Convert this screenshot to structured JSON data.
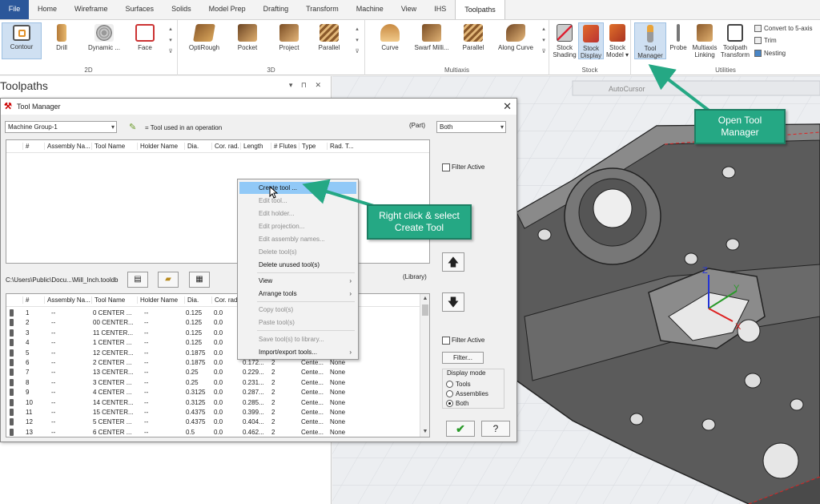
{
  "ribbon_tabs": [
    "File",
    "Home",
    "Wireframe",
    "Surfaces",
    "Solids",
    "Model Prep",
    "Drafting",
    "Transform",
    "Machine",
    "View",
    "IHS",
    "Toolpaths"
  ],
  "active_tab": "Toolpaths",
  "groups": {
    "g2d": {
      "label": "2D",
      "buttons": [
        {
          "label": "Contour",
          "icon": "contour-icon"
        },
        {
          "label": "Drill",
          "icon": "drill-icon"
        },
        {
          "label": "Dynamic ...",
          "icon": "dynamic-icon"
        },
        {
          "label": "Face",
          "icon": "face-icon"
        }
      ]
    },
    "g3d": {
      "label": "3D",
      "buttons": [
        {
          "label": "OptiRough",
          "icon": "optirough-icon"
        },
        {
          "label": "Pocket",
          "icon": "pocket-icon"
        },
        {
          "label": "Project",
          "icon": "project-icon"
        },
        {
          "label": "Parallel",
          "icon": "parallel-icon"
        }
      ]
    },
    "multiaxis": {
      "label": "Multiaxis",
      "buttons": [
        {
          "label": "Curve",
          "icon": "curve-icon"
        },
        {
          "label": "Swarf Milli...",
          "icon": "swarf-icon"
        },
        {
          "label": "Parallel",
          "icon": "parallel-icon"
        },
        {
          "label": "Along Curve",
          "icon": "along-curve-icon"
        }
      ]
    },
    "stock": {
      "label": "Stock",
      "buttons": [
        {
          "label1": "Stock",
          "label2": "Shading",
          "icon": "stock-shading-icon"
        },
        {
          "label1": "Stock",
          "label2": "Display",
          "icon": "stock-display-icon"
        },
        {
          "label1": "Stock",
          "label2": "Model ▾",
          "icon": "stock-model-icon"
        }
      ]
    },
    "utilities": {
      "label": "Utilities",
      "buttons": [
        {
          "label1": "Tool",
          "label2": "Manager",
          "icon": "tool-manager-icon"
        },
        {
          "label1": "Probe",
          "label2": "",
          "icon": "probe-icon"
        },
        {
          "label1": "Multiaxis",
          "label2": "Linking",
          "icon": "multiaxis-linking-icon"
        },
        {
          "label1": "Toolpath",
          "label2": "Transform",
          "icon": "toolpath-transform-icon"
        }
      ],
      "small": [
        "Convert to 5-axis",
        "Trim",
        "Nesting"
      ]
    }
  },
  "left_pane": {
    "title": "Toolpaths",
    "controls": "▾ ⊓ ✕"
  },
  "viewport": {
    "autocursor": "AutoCursor",
    "axes": {
      "x": "X",
      "y": "Y",
      "z": "Z"
    }
  },
  "dialog": {
    "title": "Tool Manager",
    "machine_group": "Machine Group-1",
    "legend_text": "= Tool used in an operation",
    "part_label": "(Part)",
    "filter_value": "Both",
    "columns_top": [
      "#",
      "Assembly Na...",
      "Tool Name",
      "Holder Name",
      "Dia.",
      "Cor. rad.",
      "Length",
      "# Flutes",
      "Type",
      "Rad. T..."
    ],
    "filter_active": "Filter Active",
    "library_path": "C:\\Users\\Public\\Docu...\\Mill_Inch.tooldb",
    "library_label": "(Library)",
    "columns_lib": [
      "#",
      "Assembly Na...",
      "Tool Name",
      "Holder Name",
      "Dia.",
      "Cor. rad."
    ],
    "rows": [
      {
        "n": "1",
        "asm": "--",
        "tool": "0 CENTER ...",
        "holder": "--",
        "dia": "0.125",
        "cor": "0.0",
        "len": "",
        "fl": "",
        "type": "",
        "rad": ""
      },
      {
        "n": "2",
        "asm": "--",
        "tool": "00 CENTER...",
        "holder": "--",
        "dia": "0.125",
        "cor": "0.0",
        "len": "",
        "fl": "",
        "type": "",
        "rad": ""
      },
      {
        "n": "3",
        "asm": "--",
        "tool": "11 CENTER...",
        "holder": "--",
        "dia": "0.125",
        "cor": "0.0",
        "len": "",
        "fl": "",
        "type": "",
        "rad": ""
      },
      {
        "n": "4",
        "asm": "--",
        "tool": "1 CENTER ...",
        "holder": "--",
        "dia": "0.125",
        "cor": "0.0",
        "len": "",
        "fl": "",
        "type": "",
        "rad": ""
      },
      {
        "n": "5",
        "asm": "--",
        "tool": "12 CENTER...",
        "holder": "--",
        "dia": "0.1875",
        "cor": "0.0",
        "len": "",
        "fl": "",
        "type": "",
        "rad": ""
      },
      {
        "n": "6",
        "asm": "--",
        "tool": "2 CENTER ...",
        "holder": "--",
        "dia": "0.1875",
        "cor": "0.0",
        "len": "0.172...",
        "fl": "2",
        "type": "Cente...",
        "rad": "None"
      },
      {
        "n": "7",
        "asm": "--",
        "tool": "13 CENTER...",
        "holder": "--",
        "dia": "0.25",
        "cor": "0.0",
        "len": "0.229...",
        "fl": "2",
        "type": "Cente...",
        "rad": "None"
      },
      {
        "n": "8",
        "asm": "--",
        "tool": "3 CENTER ...",
        "holder": "--",
        "dia": "0.25",
        "cor": "0.0",
        "len": "0.231...",
        "fl": "2",
        "type": "Cente...",
        "rad": "None"
      },
      {
        "n": "9",
        "asm": "--",
        "tool": "4 CENTER ...",
        "holder": "--",
        "dia": "0.3125",
        "cor": "0.0",
        "len": "0.287...",
        "fl": "2",
        "type": "Cente...",
        "rad": "None"
      },
      {
        "n": "10",
        "asm": "--",
        "tool": "14 CENTER...",
        "holder": "--",
        "dia": "0.3125",
        "cor": "0.0",
        "len": "0.285...",
        "fl": "2",
        "type": "Cente...",
        "rad": "None"
      },
      {
        "n": "11",
        "asm": "--",
        "tool": "15 CENTER...",
        "holder": "--",
        "dia": "0.4375",
        "cor": "0.0",
        "len": "0.399...",
        "fl": "2",
        "type": "Cente...",
        "rad": "None"
      },
      {
        "n": "12",
        "asm": "--",
        "tool": "5 CENTER ...",
        "holder": "--",
        "dia": "0.4375",
        "cor": "0.0",
        "len": "0.404...",
        "fl": "2",
        "type": "Cente...",
        "rad": "None"
      },
      {
        "n": "13",
        "asm": "--",
        "tool": "6 CENTER ...",
        "holder": "--",
        "dia": "0.5",
        "cor": "0.0",
        "len": "0.462...",
        "fl": "2",
        "type": "Cente...",
        "rad": "None"
      }
    ],
    "filter_button": "Filter...",
    "display_mode": {
      "label": "Display mode",
      "options": [
        "Tools",
        "Assemblies",
        "Both"
      ],
      "selected": "Both"
    }
  },
  "context_menu": [
    {
      "label": "Create tool ...",
      "state": "highlight",
      "sub": false
    },
    {
      "label": "Edit tool...",
      "state": "disabled",
      "sub": false
    },
    {
      "label": "Edit holder...",
      "state": "disabled",
      "sub": false
    },
    {
      "label": "Edit projection...",
      "state": "disabled",
      "sub": false
    },
    {
      "label": "Edit assembly names...",
      "state": "disabled",
      "sub": false
    },
    {
      "label": "Delete tool(s)",
      "state": "disabled",
      "sub": false
    },
    {
      "label": "Delete unused tool(s)",
      "state": "enabled",
      "sub": false
    },
    {
      "label": "View",
      "state": "enabled",
      "sub": true
    },
    {
      "label": "Arrange tools",
      "state": "enabled",
      "sub": true
    },
    {
      "label": "Copy tool(s)",
      "state": "disabled",
      "sub": false
    },
    {
      "label": "Paste tool(s)",
      "state": "disabled",
      "sub": false
    },
    {
      "label": "Save tool(s) to library...",
      "state": "disabled",
      "sub": false
    },
    {
      "label": "Import/export tools...",
      "state": "enabled",
      "sub": true
    }
  ],
  "callouts": {
    "right_click": {
      "line1": "Right click & select",
      "line2": "Create Tool"
    },
    "open_tm": {
      "line1": "Open Tool",
      "line2": "Manager"
    }
  },
  "colors": {
    "callout": "#25a884",
    "file_tab": "#2b579a",
    "menu_highlight": "#91c9f7"
  }
}
